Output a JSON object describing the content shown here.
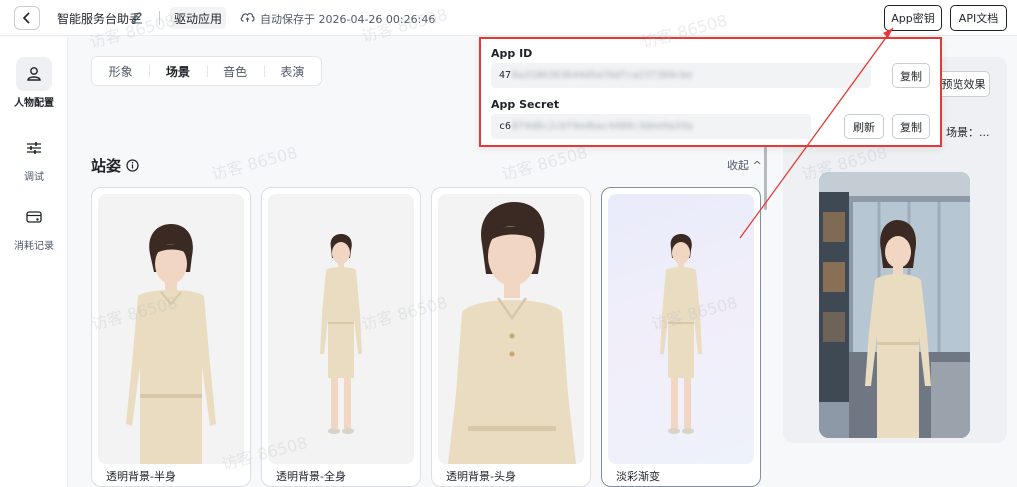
{
  "header": {
    "app_name": "智能服务台助手",
    "drive_label": "驱动应用",
    "autosave": "自动保存于 2026-04-26 00:26:46",
    "appkey_label": "App密钥",
    "apidoc_label": "API文档"
  },
  "sidebar": {
    "items": [
      {
        "label": "人物配置",
        "icon": "person-icon",
        "active": true
      },
      {
        "label": "调试",
        "icon": "sliders-icon",
        "active": false
      },
      {
        "label": "消耗记录",
        "icon": "card-icon",
        "active": false
      }
    ]
  },
  "tabs": [
    "形象",
    "场景",
    "音色",
    "表演"
  ],
  "active_tab": "场景",
  "section": {
    "title": "站姿",
    "collapse_label": "收起 ^"
  },
  "cards": [
    {
      "caption": "透明背景-半身"
    },
    {
      "caption": "透明背景-全身"
    },
    {
      "caption": "透明背景-头身"
    },
    {
      "caption": "淡彩渐变"
    }
  ],
  "preview": {
    "button_label": "预览效果",
    "scene_label": "场景：..."
  },
  "popup": {
    "app_id_label": "App ID",
    "app_id_prefix": "47",
    "app_id_masked": "0a3186363644d5a76dfca237389cbe",
    "app_secret_label": "App Secret",
    "app_secret_prefix": "c6",
    "app_secret_masked": "874d8c2cbf4edbac4489c3dee9a33a",
    "copy_label": "复制",
    "refresh_label": "刷新"
  },
  "watermark_text": "访客 86508",
  "colors": {
    "highlight": "#e53935",
    "outfit": "#e9dcc0"
  }
}
